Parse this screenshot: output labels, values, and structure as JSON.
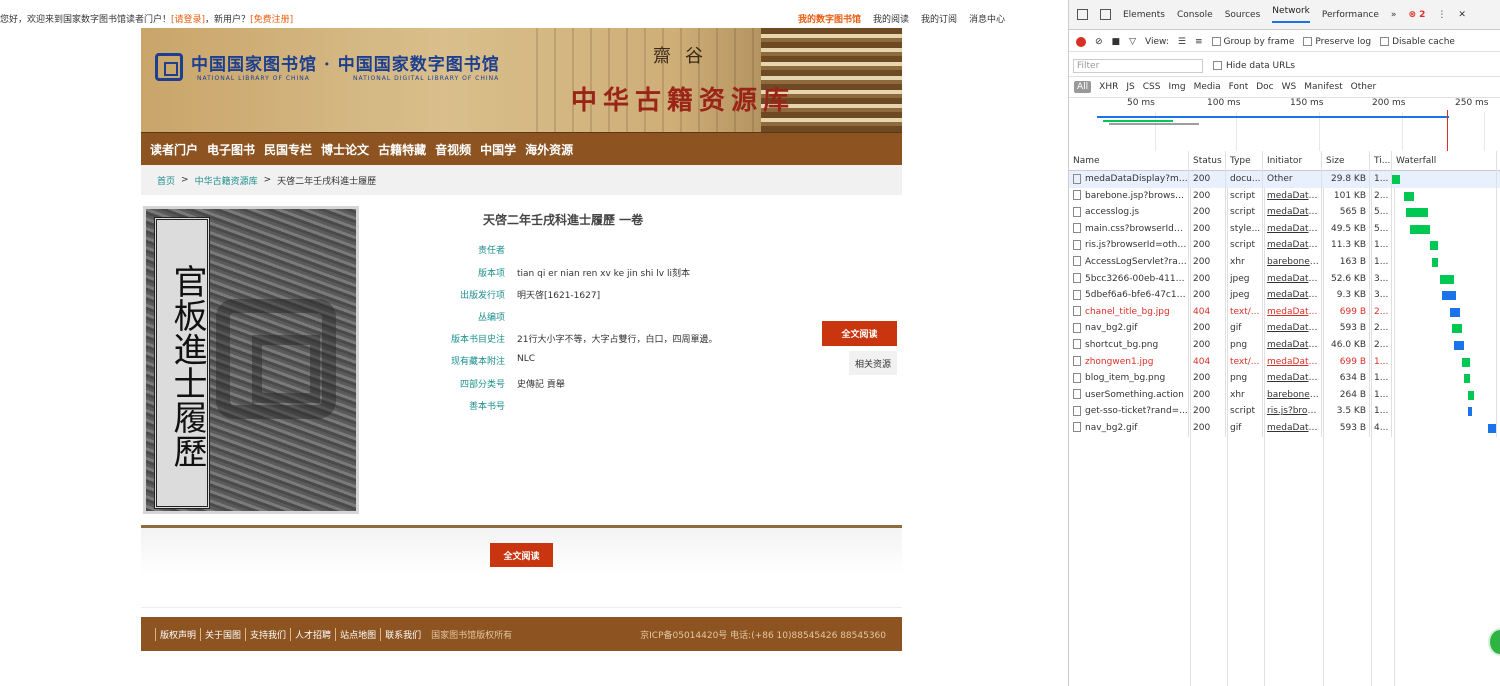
{
  "topbar": {
    "greeting": "您好，欢迎来到国家数字图书馆读者门户！",
    "login": "[请登录]",
    "new_user": "，新用户？",
    "register": "[免费注册]",
    "links": [
      "我的数字图书馆",
      "我的阅读",
      "我的订阅",
      "消息中心"
    ]
  },
  "banner": {
    "title": "中国国家图书馆 · 中国国家数字图书馆",
    "sub1": "NATIONAL LIBRARY OF CHINA",
    "sub2": "NATIONAL DIGITAL LIBRARY OF CHINA",
    "big": "中华古籍资源库",
    "seal1": "齋",
    "seal2": "谷"
  },
  "nav": [
    "读者门户",
    "电子图书",
    "民国专栏",
    "博士论文",
    "古籍特藏",
    "音视频",
    "中国学",
    "海外资源"
  ],
  "breadcrumb": [
    "首页",
    ">",
    "中华古籍资源库",
    ">",
    "天啓二年壬戌科進士履歷"
  ],
  "cover": {
    "label": "官板進士履歷"
  },
  "record": {
    "title": "天啓二年壬戌科進士履歷 一卷",
    "fields": [
      {
        "k": "责任者",
        "v": ""
      },
      {
        "k": "版本项",
        "v": "tian qi er nian ren xv ke jin shi lv li刻本"
      },
      {
        "k": "出版发行项",
        "v": "明天啓[1621-1627]"
      },
      {
        "k": "丛编项",
        "v": ""
      },
      {
        "k": "版本书目史注",
        "v": "21行大小字不等，大字占雙行，白口，四周單邊。"
      },
      {
        "k": "现有藏本附注",
        "v": "NLC"
      },
      {
        "k": "四部分类号",
        "v": "史傳記 貢舉"
      },
      {
        "k": "善本书号",
        "v": ""
      }
    ]
  },
  "buttons": {
    "read": "全文阅读",
    "related": "相关资源",
    "read2": "全文阅读"
  },
  "footer": {
    "links": [
      "版权声明",
      "关于国图",
      "支持我们",
      "人才招聘",
      "站点地图",
      "联系我们"
    ],
    "copyright": "国家图书馆版权所有",
    "icp": "京ICP备05014420号 电话:(+86 10)88545426 88545360"
  },
  "devtools": {
    "tabs": [
      "Elements",
      "Console",
      "Sources",
      "Network",
      "Performance",
      "»"
    ],
    "active_tab": "Network",
    "error_count": "2",
    "toolbar": {
      "view": "View:",
      "group": "Group by frame",
      "preserve": "Preserve log",
      "disable": "Disable cache"
    },
    "filter_placeholder": "Filter",
    "hide_data": "Hide data URLs",
    "types": [
      "All",
      "XHR",
      "JS",
      "CSS",
      "Img",
      "Media",
      "Font",
      "Doc",
      "WS",
      "Manifest",
      "Other"
    ],
    "ticks": [
      "50 ms",
      "100 ms",
      "150 ms",
      "200 ms",
      "250 ms"
    ],
    "columns": [
      "Name",
      "Status",
      "Type",
      "Initiator",
      "Size",
      "Ti...",
      "Waterfall"
    ],
    "rows": [
      {
        "name": "medaDataDisplay?me...",
        "status": "200",
        "type": "docu...",
        "init": "Other",
        "size": "29.8 KB",
        "time": "1..."
      },
      {
        "name": "barebone.jsp?browse...",
        "status": "200",
        "type": "script",
        "init": "medaData...",
        "size": "101 KB",
        "time": "2..."
      },
      {
        "name": "accesslog.js",
        "status": "200",
        "type": "script",
        "init": "medaData...",
        "size": "565 B",
        "time": "5..."
      },
      {
        "name": "main.css?browserId=...",
        "status": "200",
        "type": "style...",
        "init": "medaData...",
        "size": "49.5 KB",
        "time": "5..."
      },
      {
        "name": "ris.js?browserId=othe...",
        "status": "200",
        "type": "script",
        "init": "medaData...",
        "size": "11.3 KB",
        "time": "1..."
      },
      {
        "name": "AccessLogServlet?ran...",
        "status": "200",
        "type": "xhr",
        "init": "barebone.j...",
        "size": "163 B",
        "time": "1..."
      },
      {
        "name": "5bcc3266-00eb-4116-...",
        "status": "200",
        "type": "jpeg",
        "init": "medaData...",
        "size": "52.6 KB",
        "time": "3..."
      },
      {
        "name": "5dbef6a6-bfe6-47c1-...",
        "status": "200",
        "type": "jpeg",
        "init": "medaData...",
        "size": "9.3 KB",
        "time": "3..."
      },
      {
        "name": "chanel_title_bg.jpg",
        "status": "404",
        "type": "text/...",
        "init": "medaData...",
        "size": "699 B",
        "time": "2..."
      },
      {
        "name": "nav_bg2.gif",
        "status": "200",
        "type": "gif",
        "init": "medaData...",
        "size": "593 B",
        "time": "2..."
      },
      {
        "name": "shortcut_bg.png",
        "status": "200",
        "type": "png",
        "init": "medaData...",
        "size": "46.0 KB",
        "time": "2..."
      },
      {
        "name": "zhongwen1.jpg",
        "status": "404",
        "type": "text/...",
        "init": "medaData...",
        "size": "699 B",
        "time": "1..."
      },
      {
        "name": "blog_item_bg.png",
        "status": "200",
        "type": "png",
        "init": "medaData...",
        "size": "634 B",
        "time": "1..."
      },
      {
        "name": "userSomething.action",
        "status": "200",
        "type": "xhr",
        "init": "barebone.j...",
        "size": "264 B",
        "time": "1..."
      },
      {
        "name": "get-sso-ticket?rand=...",
        "status": "200",
        "type": "script",
        "init": "ris.js?brow...",
        "size": "3.5 KB",
        "time": "1..."
      },
      {
        "name": "nav_bg2.gif",
        "status": "200",
        "type": "gif",
        "init": "medaData...",
        "size": "593 B",
        "time": "4..."
      }
    ]
  },
  "colors": {
    "accent": "#c8350f",
    "nav_bg": "#8d5320",
    "link": "#1b8e8e",
    "error": "#d93025"
  }
}
